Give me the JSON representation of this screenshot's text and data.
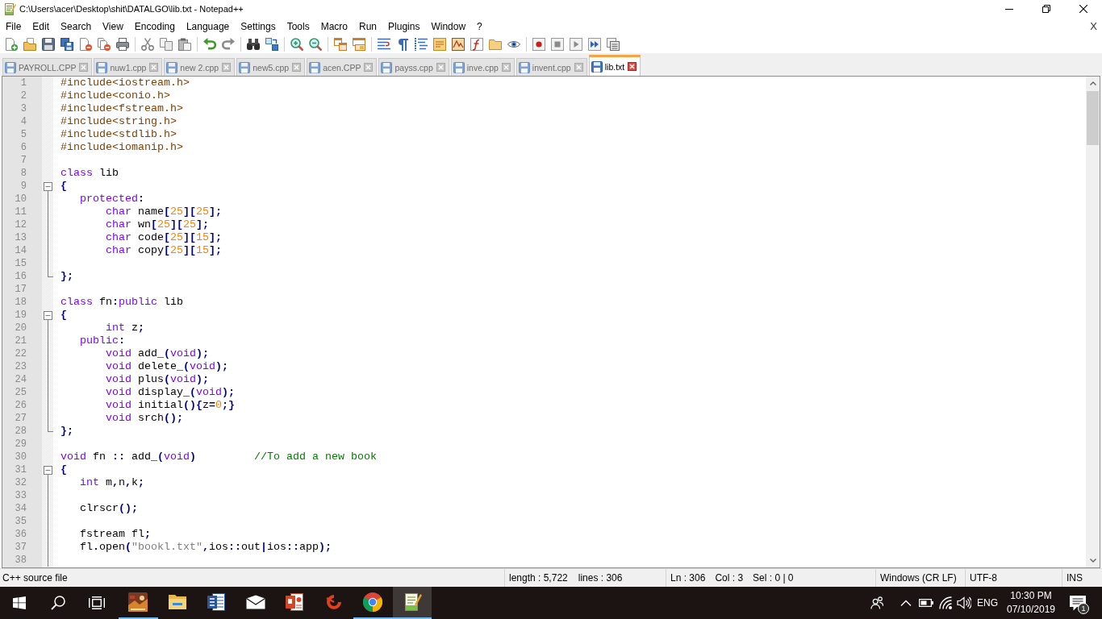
{
  "window": {
    "title": "C:\\Users\\acer\\Desktop\\shit\\DATALGO\\lib.txt - Notepad++"
  },
  "menu_bar": {
    "items": [
      "File",
      "Edit",
      "Search",
      "View",
      "Encoding",
      "Language",
      "Settings",
      "Tools",
      "Macro",
      "Run",
      "Plugins",
      "Window",
      "?"
    ],
    "close_document": "X"
  },
  "tabs": [
    {
      "label": "PAYROLL.CPP",
      "selected": false
    },
    {
      "label": "nuw1.cpp",
      "selected": false
    },
    {
      "label": "new 2.cpp",
      "selected": false
    },
    {
      "label": "new5.cpp",
      "selected": false
    },
    {
      "label": "acen.CPP",
      "selected": false
    },
    {
      "label": "payss.cpp",
      "selected": false
    },
    {
      "label": "inve.cpp",
      "selected": false
    },
    {
      "label": "invent.cpp",
      "selected": false
    },
    {
      "label": "lib.txt",
      "selected": true
    }
  ],
  "editor": {
    "lines": [
      {
        "number": "1",
        "kind": "plain",
        "tokens": [
          {
            "kind": "preprocessor",
            "text": "#include<iostream.h>"
          }
        ]
      },
      {
        "number": "2",
        "kind": "plain",
        "tokens": [
          {
            "kind": "preprocessor",
            "text": "#include<conio.h>"
          }
        ]
      },
      {
        "number": "3",
        "kind": "plain",
        "tokens": [
          {
            "kind": "preprocessor",
            "text": "#include<fstream.h>"
          }
        ]
      },
      {
        "number": "4",
        "kind": "plain",
        "tokens": [
          {
            "kind": "preprocessor",
            "text": "#include<string.h>"
          }
        ]
      },
      {
        "number": "5",
        "kind": "plain",
        "tokens": [
          {
            "kind": "preprocessor",
            "text": "#include<stdlib.h>"
          }
        ]
      },
      {
        "number": "6",
        "kind": "plain",
        "tokens": [
          {
            "kind": "preprocessor",
            "text": "#include<iomanip.h>"
          }
        ]
      },
      {
        "number": "7",
        "kind": "plain"
      },
      {
        "number": "8",
        "kind": "plain",
        "tokens": [
          {
            "kind": "keyword",
            "text": "class"
          },
          {
            "kind": "identifier",
            "text": " lib"
          }
        ]
      },
      {
        "number": "9",
        "kind": "opener",
        "tokens": [
          {
            "kind": "operator",
            "text": "{"
          }
        ]
      },
      {
        "number": "10",
        "kind": "inner",
        "tokens": [
          {
            "kind": "keyword",
            "text": "   protected"
          },
          {
            "kind": "operator",
            "text": ":"
          }
        ]
      },
      {
        "number": "11",
        "kind": "inner",
        "tokens": [
          {
            "kind": "keyword",
            "text": "       char"
          },
          {
            "kind": "identifier",
            "text": " name"
          },
          {
            "kind": "operator",
            "text": "["
          },
          {
            "kind": "number",
            "text": "25"
          },
          {
            "kind": "operator",
            "text": "]["
          },
          {
            "kind": "number",
            "text": "25"
          },
          {
            "kind": "operator",
            "text": "];"
          }
        ]
      },
      {
        "number": "12",
        "kind": "inner",
        "tokens": [
          {
            "kind": "keyword",
            "text": "       char"
          },
          {
            "kind": "identifier",
            "text": " wn"
          },
          {
            "kind": "operator",
            "text": "["
          },
          {
            "kind": "number",
            "text": "25"
          },
          {
            "kind": "operator",
            "text": "]["
          },
          {
            "kind": "number",
            "text": "25"
          },
          {
            "kind": "operator",
            "text": "];"
          }
        ]
      },
      {
        "number": "13",
        "kind": "inner",
        "tokens": [
          {
            "kind": "keyword",
            "text": "       char"
          },
          {
            "kind": "identifier",
            "text": " code"
          },
          {
            "kind": "operator",
            "text": "["
          },
          {
            "kind": "number",
            "text": "25"
          },
          {
            "kind": "operator",
            "text": "]["
          },
          {
            "kind": "number",
            "text": "15"
          },
          {
            "kind": "operator",
            "text": "];"
          }
        ]
      },
      {
        "number": "14",
        "kind": "inner",
        "tokens": [
          {
            "kind": "keyword",
            "text": "       char"
          },
          {
            "kind": "identifier",
            "text": " copy"
          },
          {
            "kind": "operator",
            "text": "["
          },
          {
            "kind": "number",
            "text": "25"
          },
          {
            "kind": "operator",
            "text": "]["
          },
          {
            "kind": "number",
            "text": "15"
          },
          {
            "kind": "operator",
            "text": "];"
          }
        ]
      },
      {
        "number": "15",
        "kind": "inner"
      },
      {
        "number": "16",
        "kind": "closer",
        "tokens": [
          {
            "kind": "operator",
            "text": "};"
          }
        ]
      },
      {
        "number": "17",
        "kind": "plain"
      },
      {
        "number": "18",
        "kind": "plain",
        "tokens": [
          {
            "kind": "keyword",
            "text": "class"
          },
          {
            "kind": "identifier",
            "text": " fn"
          },
          {
            "kind": "operator",
            "text": ":"
          },
          {
            "kind": "keyword",
            "text": "public"
          },
          {
            "kind": "identifier",
            "text": " lib"
          }
        ]
      },
      {
        "number": "19",
        "kind": "opener",
        "tokens": [
          {
            "kind": "operator",
            "text": "{"
          }
        ]
      },
      {
        "number": "20",
        "kind": "inner",
        "tokens": [
          {
            "kind": "keyword",
            "text": "       int"
          },
          {
            "kind": "identifier",
            "text": " z"
          },
          {
            "kind": "operator",
            "text": ";"
          }
        ]
      },
      {
        "number": "21",
        "kind": "inner",
        "tokens": [
          {
            "kind": "keyword",
            "text": "   public"
          },
          {
            "kind": "operator",
            "text": ":"
          }
        ]
      },
      {
        "number": "22",
        "kind": "inner",
        "tokens": [
          {
            "kind": "keyword",
            "text": "       void"
          },
          {
            "kind": "identifier",
            "text": " add_"
          },
          {
            "kind": "operator",
            "text": "("
          },
          {
            "kind": "keyword",
            "text": "void"
          },
          {
            "kind": "operator",
            "text": ");"
          }
        ]
      },
      {
        "number": "23",
        "kind": "inner",
        "tokens": [
          {
            "kind": "keyword",
            "text": "       void"
          },
          {
            "kind": "identifier",
            "text": " delete_"
          },
          {
            "kind": "operator",
            "text": "("
          },
          {
            "kind": "keyword",
            "text": "void"
          },
          {
            "kind": "operator",
            "text": ");"
          }
        ]
      },
      {
        "number": "24",
        "kind": "inner",
        "tokens": [
          {
            "kind": "keyword",
            "text": "       void"
          },
          {
            "kind": "identifier",
            "text": " plus"
          },
          {
            "kind": "operator",
            "text": "("
          },
          {
            "kind": "keyword",
            "text": "void"
          },
          {
            "kind": "operator",
            "text": ");"
          }
        ]
      },
      {
        "number": "25",
        "kind": "inner",
        "tokens": [
          {
            "kind": "keyword",
            "text": "       void"
          },
          {
            "kind": "identifier",
            "text": " display_"
          },
          {
            "kind": "operator",
            "text": "("
          },
          {
            "kind": "keyword",
            "text": "void"
          },
          {
            "kind": "operator",
            "text": ");"
          }
        ]
      },
      {
        "number": "26",
        "kind": "inner",
        "tokens": [
          {
            "kind": "keyword",
            "text": "       void"
          },
          {
            "kind": "identifier",
            "text": " initial"
          },
          {
            "kind": "operator",
            "text": "(){"
          },
          {
            "kind": "identifier",
            "text": "z"
          },
          {
            "kind": "operator",
            "text": "="
          },
          {
            "kind": "number",
            "text": "0"
          },
          {
            "kind": "operator",
            "text": ";}"
          }
        ]
      },
      {
        "number": "27",
        "kind": "inner",
        "tokens": [
          {
            "kind": "keyword",
            "text": "       void"
          },
          {
            "kind": "identifier",
            "text": " srch"
          },
          {
            "kind": "operator",
            "text": "();"
          }
        ]
      },
      {
        "number": "28",
        "kind": "closer",
        "tokens": [
          {
            "kind": "operator",
            "text": "};"
          }
        ]
      },
      {
        "number": "29",
        "kind": "plain"
      },
      {
        "number": "30",
        "kind": "plain",
        "tokens": [
          {
            "kind": "keyword",
            "text": "void"
          },
          {
            "kind": "identifier",
            "text": " fn "
          },
          {
            "kind": "operator",
            "text": "::"
          },
          {
            "kind": "identifier",
            "text": " add_"
          },
          {
            "kind": "operator",
            "text": "("
          },
          {
            "kind": "keyword",
            "text": "void"
          },
          {
            "kind": "operator",
            "text": ")"
          },
          {
            "kind": "comment",
            "text": "         //To add a new book"
          }
        ]
      },
      {
        "number": "31",
        "kind": "opener",
        "tokens": [
          {
            "kind": "operator",
            "text": "{"
          }
        ]
      },
      {
        "number": "32",
        "kind": "inner",
        "tokens": [
          {
            "kind": "keyword",
            "text": "   int"
          },
          {
            "kind": "identifier",
            "text": " m"
          },
          {
            "kind": "operator",
            "text": ","
          },
          {
            "kind": "identifier",
            "text": "n"
          },
          {
            "kind": "operator",
            "text": ","
          },
          {
            "kind": "identifier",
            "text": "k"
          },
          {
            "kind": "operator",
            "text": ";"
          }
        ]
      },
      {
        "number": "33",
        "kind": "inner"
      },
      {
        "number": "34",
        "kind": "inner",
        "tokens": [
          {
            "kind": "identifier",
            "text": "   clrscr"
          },
          {
            "kind": "operator",
            "text": "();"
          }
        ]
      },
      {
        "number": "35",
        "kind": "inner"
      },
      {
        "number": "36",
        "kind": "inner",
        "tokens": [
          {
            "kind": "identifier",
            "text": "   fstream fl"
          },
          {
            "kind": "operator",
            "text": ";"
          }
        ]
      },
      {
        "number": "37",
        "kind": "inner",
        "tokens": [
          {
            "kind": "identifier",
            "text": "   fl"
          },
          {
            "kind": "operator",
            "text": "."
          },
          {
            "kind": "identifier",
            "text": "open"
          },
          {
            "kind": "operator",
            "text": "("
          },
          {
            "kind": "string",
            "text": "\"bookl.txt\""
          },
          {
            "kind": "operator",
            "text": ","
          },
          {
            "kind": "identifier",
            "text": "ios"
          },
          {
            "kind": "operator",
            "text": "::"
          },
          {
            "kind": "identifier",
            "text": "out"
          },
          {
            "kind": "operator",
            "text": "|"
          },
          {
            "kind": "identifier",
            "text": "ios"
          },
          {
            "kind": "operator",
            "text": "::"
          },
          {
            "kind": "identifier",
            "text": "app"
          },
          {
            "kind": "operator",
            "text": ");"
          }
        ]
      },
      {
        "number": "38",
        "kind": "inner"
      }
    ]
  },
  "status_bar": {
    "file_type": "C++ source file",
    "length": "length : 5,722",
    "lines": "lines : 306",
    "line": "Ln : 306",
    "column": "Col : 3",
    "selection": "Sel : 0 | 0",
    "line_ending": "Windows (CR LF)",
    "encoding": "UTF-8",
    "mode": "INS"
  },
  "taskbar": {
    "apps": [
      {
        "running": true,
        "selected": false
      },
      {
        "running": false,
        "selected": false
      },
      {
        "running": false,
        "selected": false
      },
      {
        "running": false,
        "selected": false
      },
      {
        "running": false,
        "selected": false
      },
      {
        "running": false,
        "selected": false
      },
      {
        "running": true,
        "selected": false
      },
      {
        "running": true,
        "selected": true
      }
    ],
    "language": "ENG",
    "time": "10:30 PM",
    "date": "07/10/2019",
    "notifications": "1"
  }
}
